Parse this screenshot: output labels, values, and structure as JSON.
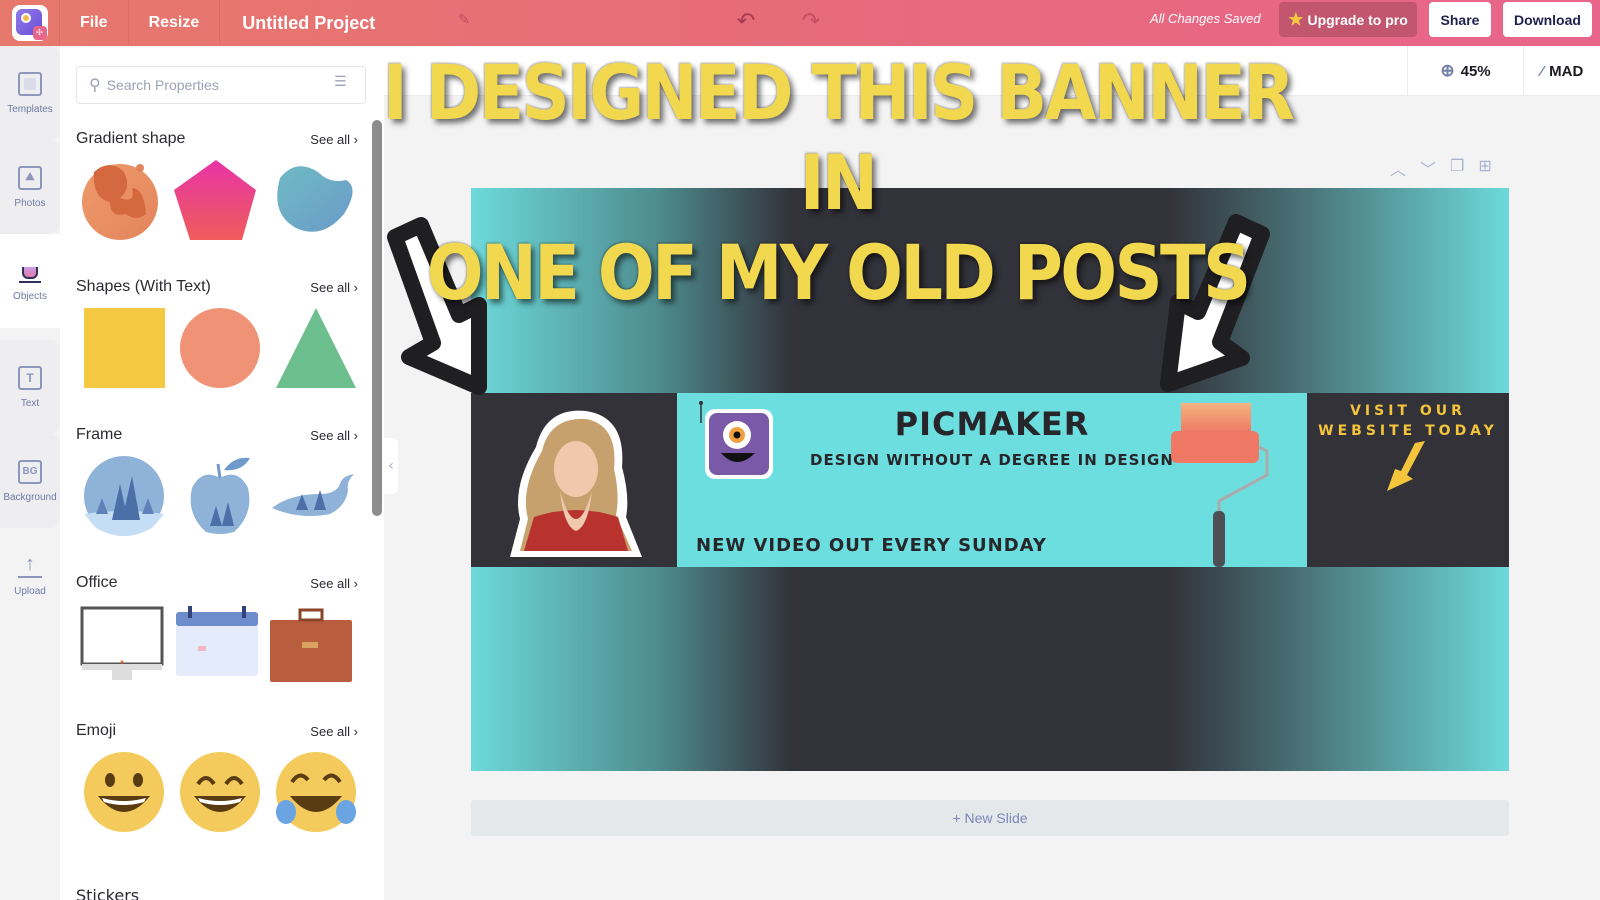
{
  "topbar": {
    "menu": [
      "File",
      "Resize"
    ],
    "project_title": "Untitled Project",
    "save_status": "All Changes Saved",
    "upgrade_label": "Upgrade to pro",
    "share_label": "Share",
    "download_label": "Download",
    "brand_color": "#e76c78"
  },
  "rail": {
    "items": [
      {
        "label": "Templates",
        "icon": "templates-icon"
      },
      {
        "label": "Photos",
        "icon": "photos-icon"
      },
      {
        "label": "Objects",
        "icon": "objects-icon",
        "active": true
      },
      {
        "label": "Text",
        "icon": "text-icon",
        "glyph": "T"
      },
      {
        "label": "Background",
        "icon": "background-icon",
        "glyph": "BG"
      },
      {
        "label": "Upload",
        "icon": "upload-icon"
      }
    ]
  },
  "panel": {
    "search_placeholder": "Search Properties",
    "see_all": "See all",
    "sections": [
      {
        "title": "Gradient shape"
      },
      {
        "title": "Shapes (With Text)"
      },
      {
        "title": "Frame"
      },
      {
        "title": "Office"
      },
      {
        "title": "Emoji"
      }
    ]
  },
  "canvas_toolbar": {
    "zoom_level": "45%",
    "magic_label": "MAD"
  },
  "slide": {
    "brand_title": "PICMAKER",
    "brand_subtitle": "DESIGN WITHOUT A DEGREE IN DESIGN",
    "footer": "NEW VIDEO OUT EVERY SUNDAY",
    "cta_line1": "VISIT OUR",
    "cta_line2": "WEBSITE TODAY",
    "teal": "#6ddedf",
    "dark": "#333238",
    "accent_yellow": "#f3c43c"
  },
  "new_slide_label": "+ New Slide",
  "overlay": {
    "line1": "I DESIGNED THIS BANNER IN",
    "line2": "ONE OF MY OLD POSTS",
    "color": "#f2d84f"
  }
}
